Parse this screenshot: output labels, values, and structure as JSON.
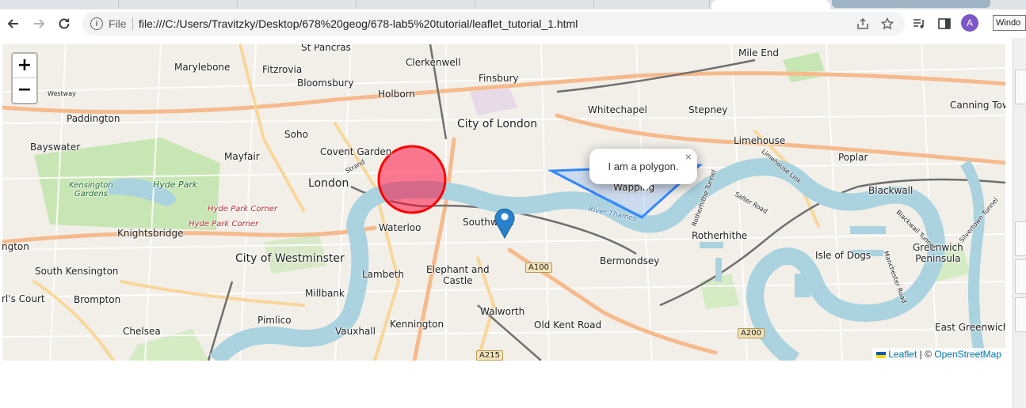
{
  "browser": {
    "scheme_label": "File",
    "url": "file:///C:/Users/Travitzky/Desktop/678%20geog/678-lab5%20tutorial/leaflet_tutorial_1.html",
    "avatar_letter": "A",
    "tooltip_text": "Windo",
    "icons": {
      "back": "back-arrow-icon",
      "forward": "forward-arrow-icon",
      "reload": "reload-icon",
      "info": "info-icon",
      "share": "share-icon",
      "bookmark": "star-icon",
      "media": "media-queue-icon",
      "sidepanel": "side-panel-icon"
    }
  },
  "map": {
    "zoom_in_label": "+",
    "zoom_out_label": "−",
    "popup_text": "I am a polygon.",
    "popup_close": "×",
    "attribution": {
      "leaflet": "Leaflet",
      "separator": " | © ",
      "osm": "OpenStreetMap"
    },
    "circle_color": "#ff0000",
    "circle_fill": "#f03",
    "polygon_color": "#3388ff",
    "marker_color": "#2a81cb",
    "places": {
      "st_pancras": "St Pancras",
      "clerkenwell": "Clerkenwell",
      "mile_end": "Mile End",
      "marylebone": "Marylebone",
      "fitzrovia": "Fitzrovia",
      "bloomsbury": "Bloomsbury",
      "finsbury": "Finsbury",
      "westway": "Westway",
      "holborn": "Holborn",
      "whitechapel": "Whitechapel",
      "stepney": "Stepney",
      "canning_town": "Canning Town",
      "paddington": "Paddington",
      "city_of_london": "City of London",
      "soho": "Soho",
      "limehouse": "Limehouse",
      "bayswater": "Bayswater",
      "covent_garden": "Covent Garden",
      "mayfair": "Mayfair",
      "strand": "Strand",
      "poplar": "Poplar",
      "kensington_gardens": "Kensington\nGardens",
      "hyde_park": "Hyde Park",
      "london": "London",
      "wapping": "Wapping",
      "blackwall": "Blackwall",
      "hyde_park_corner_1": "Hyde Park Corner",
      "hyde_park_corner_2": "Hyde Park Corner",
      "southwark": "Southwark",
      "waterloo": "Waterloo",
      "knightsbridge": "Knightsbridge",
      "rotherhithe": "Rotherhithe",
      "ngton": "ngton",
      "city_of_westminster": "City of Westminster",
      "bermondsey": "Bermondsey",
      "isle_of_dogs": "Isle of Dogs",
      "greenwich_peninsula": "Greenwich\nPeninsula",
      "south_kensington": "South Kensington",
      "lambeth": "Lambeth",
      "elephant_and_castle": "Elephant and\nCastle",
      "earls_court": "rl's Court",
      "brompton": "Brompton",
      "millbank": "Millbank",
      "pimlico": "Pimlico",
      "walworth": "Walworth",
      "kennington": "Kennington",
      "old_kent_road": "Old Kent Road",
      "chelsea": "Chelsea",
      "vauxhall": "Vauxhall",
      "east_greenwich": "East Greenwich",
      "river_thames": "River Thames",
      "limehouse_link": "Limehouse Link",
      "salter_road": "Salter Road",
      "rotherhithe_tunnel": "Rotherhithe Tunnel",
      "manchester_road": "Manchester Road",
      "blackwall_tunnel": "Blackwall Tunnel",
      "silvertown_tunnel": "Silvertown Tunnel"
    },
    "shields": {
      "a100": "A100",
      "a200": "A200",
      "a215": "A215"
    }
  }
}
